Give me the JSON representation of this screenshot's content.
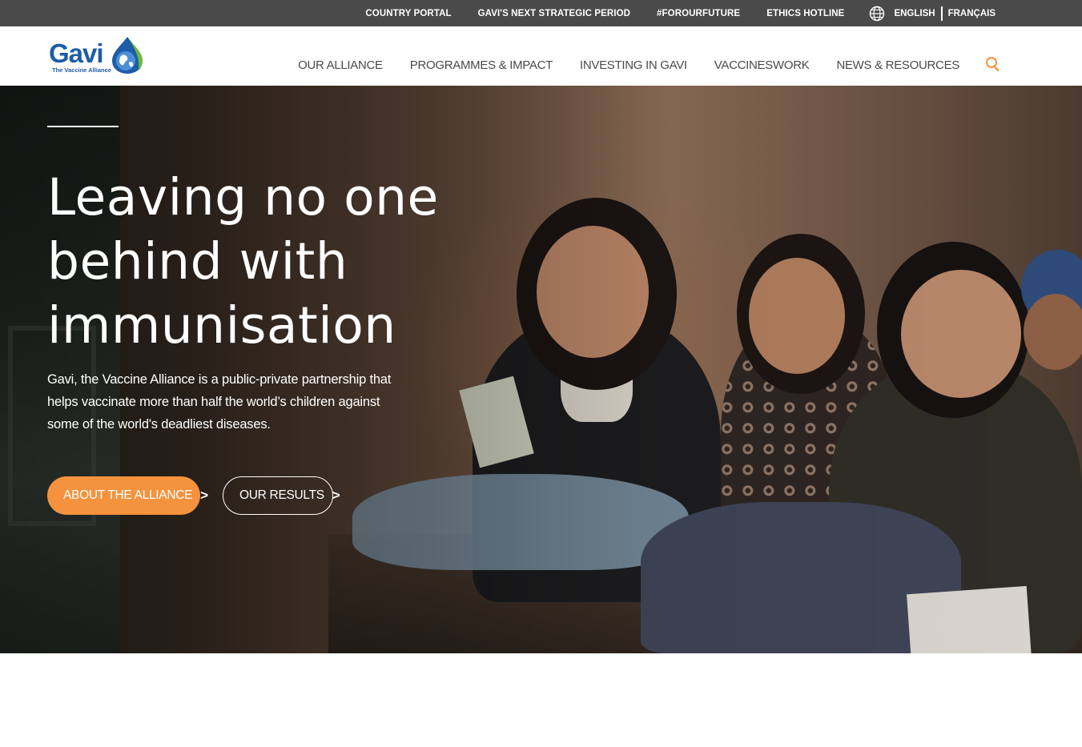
{
  "utility": {
    "links": [
      "COUNTRY PORTAL",
      "GAVI'S NEXT STRATEGIC PERIOD",
      "#FOROURFUTURE",
      "ETHICS HOTLINE"
    ],
    "languages": [
      "ENGLISH",
      "FRANÇAIS"
    ]
  },
  "logo": {
    "wordmark": "Gavi",
    "tagline": "The Vaccine Alliance"
  },
  "nav": {
    "items": [
      "OUR ALLIANCE",
      "PROGRAMMES & IMPACT",
      "INVESTING IN GAVI",
      "VACCINESWORK",
      "NEWS & RESOURCES"
    ]
  },
  "hero": {
    "title": "Leaving no one behind with immunisation",
    "text": "Gavi, the Vaccine Alliance is a public-private partnership that helps vaccinate more than half the world’s children against some of the world's deadliest diseases.",
    "primary_button": "ABOUT THE ALLIANCE",
    "secondary_button": "OUR RESULTS",
    "arrow": ">"
  },
  "colors": {
    "utility_bar": "#4a4a4a",
    "brand_blue": "#1d5ca8",
    "accent_orange": "#f5923e",
    "nav_text": "#4a4a4a"
  },
  "icons": {
    "language": "globe-icon",
    "search": "search-icon"
  }
}
